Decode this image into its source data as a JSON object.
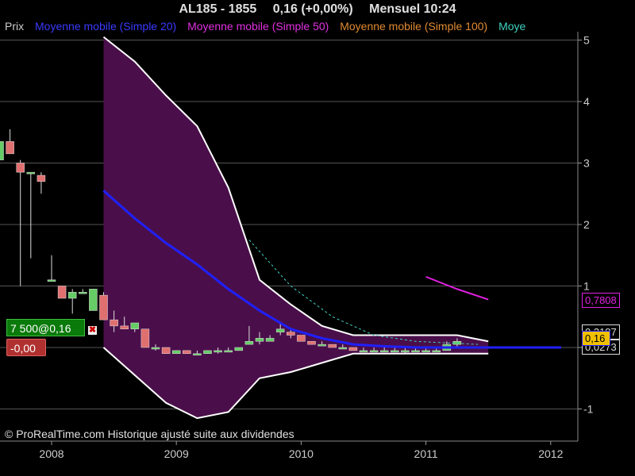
{
  "header": {
    "symbol": "AL185 - 1855",
    "price": "0,16 (+0,00%)",
    "period_time": "Mensuel  10:24"
  },
  "legend": {
    "price": "Prix",
    "ma20": "Moyenne mobile (Simple 20)",
    "ma50": "Moyenne mobile (Simple 50)",
    "ma100": "Moyenne mobile (Simple 100)",
    "ma_cut": "Moye"
  },
  "order": {
    "label": "7 500@0,16",
    "close_symbol": "✖",
    "pnl": "-0,00"
  },
  "price_labels": {
    "ma50": "0,7808",
    "upper": "0,2187",
    "last": "0,16",
    "lower": "0,0273"
  },
  "credit": "© ProRealTime.com Historique ajusté suite aux dividendes",
  "colors": {
    "up_candle": "#66cc66",
    "down_candle": "#e07070",
    "ma20": "#2020ff",
    "ma50": "#e020e0",
    "ma100": "#e08020",
    "ma200": "#40d0c0",
    "band_fill": "#4a0f4a",
    "grid": "#555555"
  },
  "chart_data": {
    "type": "candlestick",
    "title": "AL185 - 1855",
    "period": "Mensuel",
    "y_ticks": [
      "5",
      "4",
      "3",
      "2",
      "1",
      "0",
      "-1"
    ],
    "x_ticks": [
      "2008",
      "2009",
      "2010",
      "2011",
      "2012"
    ],
    "ylim": [
      -1.5,
      5.1
    ],
    "grid": true,
    "candles": [
      {
        "date": "2007-08",
        "o": 3.05,
        "h": 3.45,
        "l": 3.05,
        "c": 3.35
      },
      {
        "date": "2007-09",
        "o": 3.35,
        "h": 3.55,
        "l": 3.15,
        "c": 3.15
      },
      {
        "date": "2007-10",
        "o": 3.0,
        "h": 3.05,
        "l": 1.0,
        "c": 2.85
      },
      {
        "date": "2007-11",
        "o": 2.85,
        "h": 2.85,
        "l": 1.45,
        "c": 2.85
      },
      {
        "date": "2007-12",
        "o": 2.8,
        "h": 2.85,
        "l": 2.5,
        "c": 2.7
      },
      {
        "date": "2008-01",
        "o": 1.1,
        "h": 1.5,
        "l": 1.1,
        "c": 1.1
      },
      {
        "date": "2008-02",
        "o": 1.0,
        "h": 1.0,
        "l": 0.8,
        "c": 0.8
      },
      {
        "date": "2008-03",
        "o": 0.8,
        "h": 0.95,
        "l": 0.55,
        "c": 0.9
      },
      {
        "date": "2008-04",
        "o": 0.9,
        "h": 0.95,
        "l": 0.9,
        "c": 0.9
      },
      {
        "date": "2008-05",
        "o": 0.6,
        "h": 0.95,
        "l": 0.6,
        "c": 0.95
      },
      {
        "date": "2008-06",
        "o": 0.85,
        "h": 0.9,
        "l": 0.45,
        "c": 0.45
      },
      {
        "date": "2008-07",
        "o": 0.45,
        "h": 0.6,
        "l": 0.25,
        "c": 0.35
      },
      {
        "date": "2008-08",
        "o": 0.35,
        "h": 0.5,
        "l": 0.3,
        "c": 0.3
      },
      {
        "date": "2008-09",
        "o": 0.3,
        "h": 0.4,
        "l": 0.25,
        "c": 0.4
      },
      {
        "date": "2008-10",
        "o": 0.3,
        "h": 0.3,
        "l": 0.0,
        "c": 0.0
      },
      {
        "date": "2008-11",
        "o": 0.0,
        "h": 0.05,
        "l": -0.05,
        "c": 0.0
      },
      {
        "date": "2008-12",
        "o": 0.0,
        "h": 0.0,
        "l": -0.1,
        "c": -0.1
      },
      {
        "date": "2009-01",
        "o": -0.1,
        "h": -0.05,
        "l": -0.1,
        "c": -0.05
      },
      {
        "date": "2009-02",
        "o": -0.05,
        "h": -0.05,
        "l": -0.1,
        "c": -0.1
      },
      {
        "date": "2009-03",
        "o": -0.1,
        "h": -0.05,
        "l": -0.1,
        "c": -0.1
      },
      {
        "date": "2009-04",
        "o": -0.1,
        "h": -0.05,
        "l": -0.1,
        "c": -0.05
      },
      {
        "date": "2009-05",
        "o": -0.05,
        "h": 0.0,
        "l": -0.1,
        "c": -0.05
      },
      {
        "date": "2009-06",
        "o": -0.05,
        "h": 0.0,
        "l": -0.05,
        "c": -0.05
      },
      {
        "date": "2009-07",
        "o": -0.05,
        "h": 0.0,
        "l": -0.05,
        "c": 0.0
      },
      {
        "date": "2009-08",
        "o": 0.05,
        "h": 0.35,
        "l": 0.05,
        "c": 0.1
      },
      {
        "date": "2009-09",
        "o": 0.1,
        "h": 0.25,
        "l": 0.05,
        "c": 0.15
      },
      {
        "date": "2009-10",
        "o": 0.1,
        "h": 0.2,
        "l": 0.1,
        "c": 0.15
      },
      {
        "date": "2009-11",
        "o": 0.25,
        "h": 0.4,
        "l": 0.2,
        "c": 0.3
      },
      {
        "date": "2009-12",
        "o": 0.25,
        "h": 0.3,
        "l": 0.15,
        "c": 0.2
      },
      {
        "date": "2010-01",
        "o": 0.2,
        "h": 0.2,
        "l": 0.1,
        "c": 0.1
      },
      {
        "date": "2010-02",
        "o": 0.1,
        "h": 0.1,
        "l": 0.05,
        "c": 0.05
      },
      {
        "date": "2010-03",
        "o": 0.05,
        "h": 0.1,
        "l": 0.05,
        "c": 0.05
      },
      {
        "date": "2010-04",
        "o": 0.05,
        "h": 0.05,
        "l": 0.0,
        "c": 0.0
      },
      {
        "date": "2010-05",
        "o": 0.0,
        "h": 0.05,
        "l": 0.0,
        "c": 0.0
      },
      {
        "date": "2010-06",
        "o": 0.0,
        "h": 0.0,
        "l": -0.05,
        "c": -0.05
      },
      {
        "date": "2010-07",
        "o": -0.05,
        "h": 0.0,
        "l": -0.05,
        "c": -0.05
      },
      {
        "date": "2010-08",
        "o": -0.05,
        "h": 0.0,
        "l": -0.05,
        "c": -0.05
      },
      {
        "date": "2010-09",
        "o": -0.05,
        "h": 0.0,
        "l": -0.05,
        "c": -0.05
      },
      {
        "date": "2010-10",
        "o": -0.05,
        "h": 0.0,
        "l": -0.05,
        "c": -0.05
      },
      {
        "date": "2010-11",
        "o": -0.05,
        "h": 0.0,
        "l": -0.1,
        "c": -0.05
      },
      {
        "date": "2010-12",
        "o": -0.05,
        "h": 0.0,
        "l": -0.05,
        "c": -0.05
      },
      {
        "date": "2011-01",
        "o": -0.05,
        "h": 0.0,
        "l": -0.05,
        "c": -0.05
      },
      {
        "date": "2011-02",
        "o": -0.05,
        "h": 0.0,
        "l": -0.05,
        "c": -0.05
      },
      {
        "date": "2011-03",
        "o": -0.05,
        "h": 0.1,
        "l": -0.05,
        "c": 0.05
      },
      {
        "date": "2011-04",
        "o": 0.05,
        "h": 0.15,
        "l": 0.0,
        "c": 0.1
      }
    ],
    "ma20": [
      {
        "date": "2008-06",
        "v": 2.55
      },
      {
        "date": "2008-09",
        "v": 2.1
      },
      {
        "date": "2008-12",
        "v": 1.7
      },
      {
        "date": "2009-03",
        "v": 1.35
      },
      {
        "date": "2009-06",
        "v": 0.95
      },
      {
        "date": "2009-09",
        "v": 0.6
      },
      {
        "date": "2009-12",
        "v": 0.3
      },
      {
        "date": "2010-03",
        "v": 0.15
      },
      {
        "date": "2010-06",
        "v": 0.05
      },
      {
        "date": "2010-09",
        "v": 0.02
      },
      {
        "date": "2010-12",
        "v": 0.0
      },
      {
        "date": "2011-03",
        "v": 0.0
      },
      {
        "date": "2011-06",
        "v": 0.0
      },
      {
        "date": "2012-02",
        "v": 0.0
      }
    ],
    "ma50": [
      {
        "date": "2011-01",
        "v": 1.15
      },
      {
        "date": "2011-04",
        "v": 0.95
      },
      {
        "date": "2011-07",
        "v": 0.78
      }
    ],
    "ma200": [
      {
        "date": "2009-08",
        "v": 1.75
      },
      {
        "date": "2009-12",
        "v": 1.0
      },
      {
        "date": "2010-04",
        "v": 0.5
      },
      {
        "date": "2010-08",
        "v": 0.2
      },
      {
        "date": "2010-12",
        "v": 0.1
      },
      {
        "date": "2011-06",
        "v": 0.05
      }
    ],
    "bollinger": {
      "upper": [
        {
          "date": "2008-06",
          "v": 5.05
        },
        {
          "date": "2008-09",
          "v": 4.65
        },
        {
          "date": "2008-12",
          "v": 4.1
        },
        {
          "date": "2009-03",
          "v": 3.6
        },
        {
          "date": "2009-06",
          "v": 2.6
        },
        {
          "date": "2009-09",
          "v": 1.1
        },
        {
          "date": "2009-12",
          "v": 0.7
        },
        {
          "date": "2010-03",
          "v": 0.35
        },
        {
          "date": "2010-06",
          "v": 0.2
        },
        {
          "date": "2010-12",
          "v": 0.2
        },
        {
          "date": "2011-04",
          "v": 0.2
        },
        {
          "date": "2011-07",
          "v": 0.1
        }
      ],
      "lower": [
        {
          "date": "2008-06",
          "v": 0.0
        },
        {
          "date": "2008-09",
          "v": -0.45
        },
        {
          "date": "2008-12",
          "v": -0.9
        },
        {
          "date": "2009-03",
          "v": -1.15
        },
        {
          "date": "2009-06",
          "v": -1.05
        },
        {
          "date": "2009-09",
          "v": -0.5
        },
        {
          "date": "2009-12",
          "v": -0.4
        },
        {
          "date": "2010-03",
          "v": -0.25
        },
        {
          "date": "2010-06",
          "v": -0.1
        },
        {
          "date": "2010-12",
          "v": -0.1
        },
        {
          "date": "2011-04",
          "v": -0.1
        },
        {
          "date": "2011-07",
          "v": -0.1
        }
      ]
    }
  }
}
